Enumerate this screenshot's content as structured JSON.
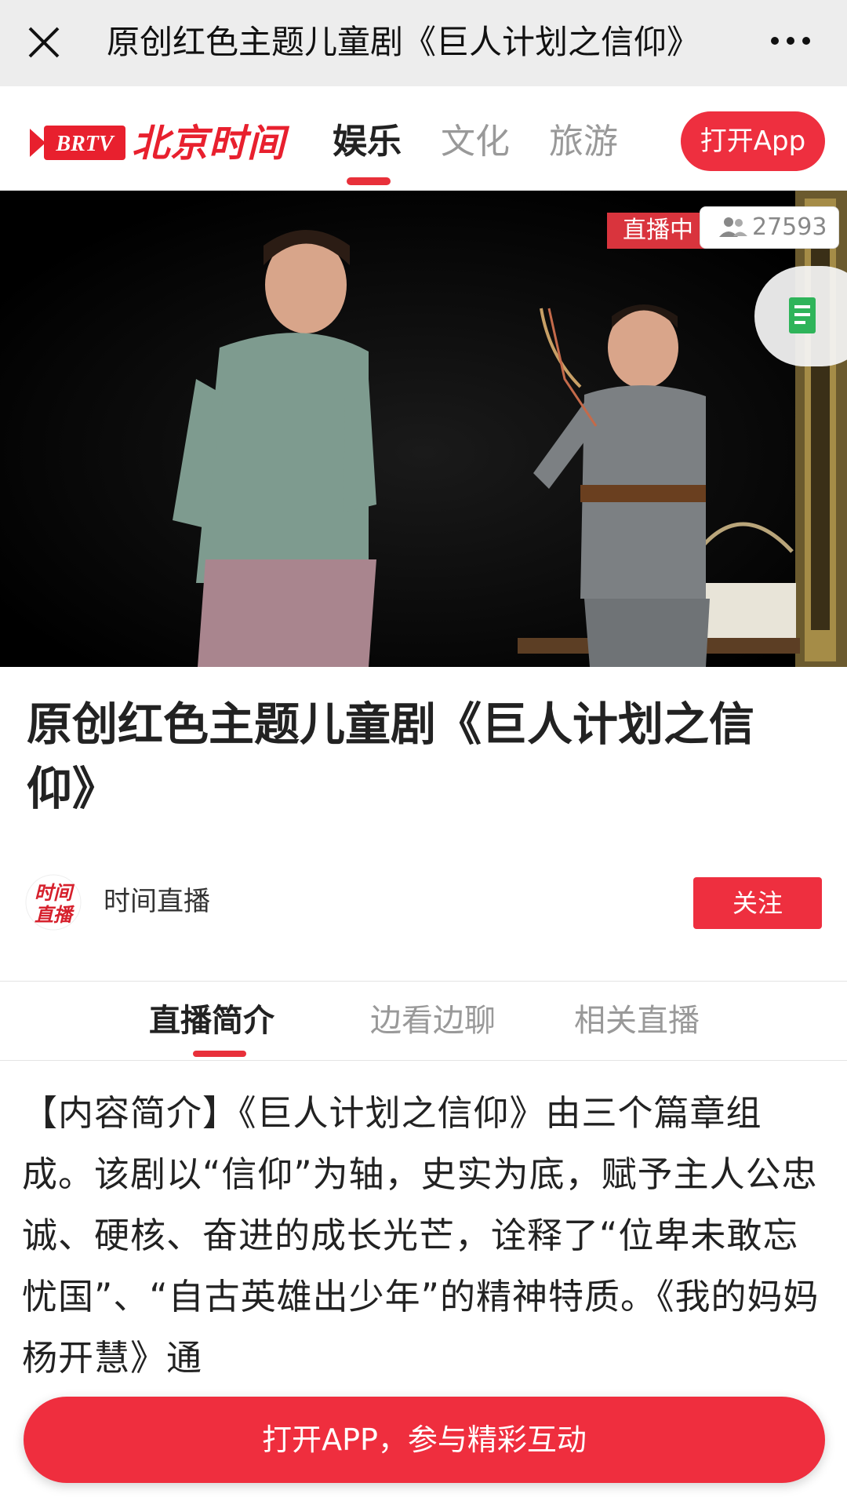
{
  "topbar": {
    "title": "原创红色主题儿童剧《巨人计划之信仰》"
  },
  "header": {
    "logo_badge": "BRTV",
    "logo_brand": "北京时间",
    "tabs": [
      {
        "label": "娱乐",
        "active": true
      },
      {
        "label": "文化",
        "active": false
      },
      {
        "label": "旅游",
        "active": false
      }
    ],
    "open_app_label": "打开App"
  },
  "video": {
    "live_label": "直播中",
    "viewer_count": "27593"
  },
  "article": {
    "title": "原创红色主题儿童剧《巨人计划之信仰》",
    "author": "时间直播",
    "avatar_text_line1": "时间",
    "avatar_text_line2": "直播",
    "follow_label": "关注"
  },
  "content_tabs": [
    {
      "label": "直播简介",
      "active": true
    },
    {
      "label": "边看边聊",
      "active": false
    },
    {
      "label": "相关直播",
      "active": false
    }
  ],
  "intro_text": "【内容简介】《巨人计划之信仰》由三个篇章组成。该剧以“信仰”为轴，史实为底，赋予主人公忠诚、硬核、奋进的成长光芒，诠释了“位卑未敢忘忧国”、“自古英雄出少年”的精神特质。《我的妈妈杨开慧》通",
  "bottom_cta": "打开APP，参与精彩互动",
  "colors": {
    "accent": "#ee2f3f",
    "topbar_bg": "#ededed"
  }
}
